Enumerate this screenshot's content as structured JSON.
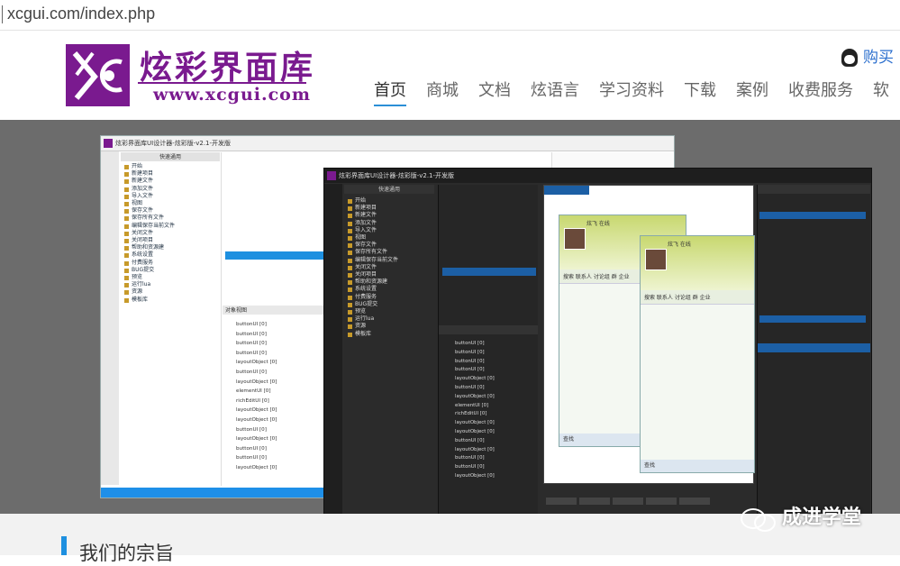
{
  "browser": {
    "url": "xcgui.com/index.php"
  },
  "header": {
    "brand_name": "炫彩界面库",
    "brand_url": "www.xcgui.com",
    "buy_label": "购买",
    "nav": [
      {
        "label": "首页",
        "active": true
      },
      {
        "label": "商城",
        "active": false
      },
      {
        "label": "文档",
        "active": false
      },
      {
        "label": "炫语言",
        "active": false
      },
      {
        "label": "学习资料",
        "active": false
      },
      {
        "label": "下载",
        "active": false
      },
      {
        "label": "案例",
        "active": false
      },
      {
        "label": "收费服务",
        "active": false
      },
      {
        "label": "软",
        "active": false
      }
    ]
  },
  "banner": {
    "slides_total": 3,
    "active_slide": 1,
    "window_light_title": "炫彩界面库UI设计器-炫彩版-v2.1-开发版",
    "window_dark_title": "炫彩界面库UI设计器-炫彩版-v2.1-开发版",
    "panel_label": "快速通用",
    "tree_items": [
      "开始",
      "新建项目",
      "新建文件",
      "添加文件",
      "导入文件",
      "视图",
      "保存文件",
      "保存所有文件",
      "编辑保存当前文件",
      "关闭文件",
      "关闭项目",
      "帮助和资源建",
      "系统设置",
      "付费服务",
      "BUG提交"
    ],
    "tree_bottom": [
      "预览",
      "运行lua",
      "资源",
      "模板库"
    ],
    "object_view_label": "对象视图",
    "object_items": [
      "buttonUI [0]",
      "buttonUI [0]",
      "buttonUI [0]",
      "buttonUI [0]",
      "layoutObject [0]",
      "buttonUI [0]",
      "layoutObject [0]",
      "elementUI [0]",
      "richEditUI [0]",
      "layoutObject [0]",
      "layoutObject [0]",
      "buttonUI [0]",
      "layoutObject [0]",
      "buttonUI [0]",
      "buttonUI [0]",
      "layoutObject [0]"
    ],
    "chat_name": "炫飞 在线",
    "chat_tabs": "搜索 联系人 讨论组 群 企业",
    "chat_footer": "查找"
  },
  "section": {
    "heading": "我们的宗旨"
  },
  "watermark": {
    "text": "成进学堂"
  },
  "colors": {
    "brand": "#7a1a8f",
    "accent": "#2b8fd6"
  }
}
